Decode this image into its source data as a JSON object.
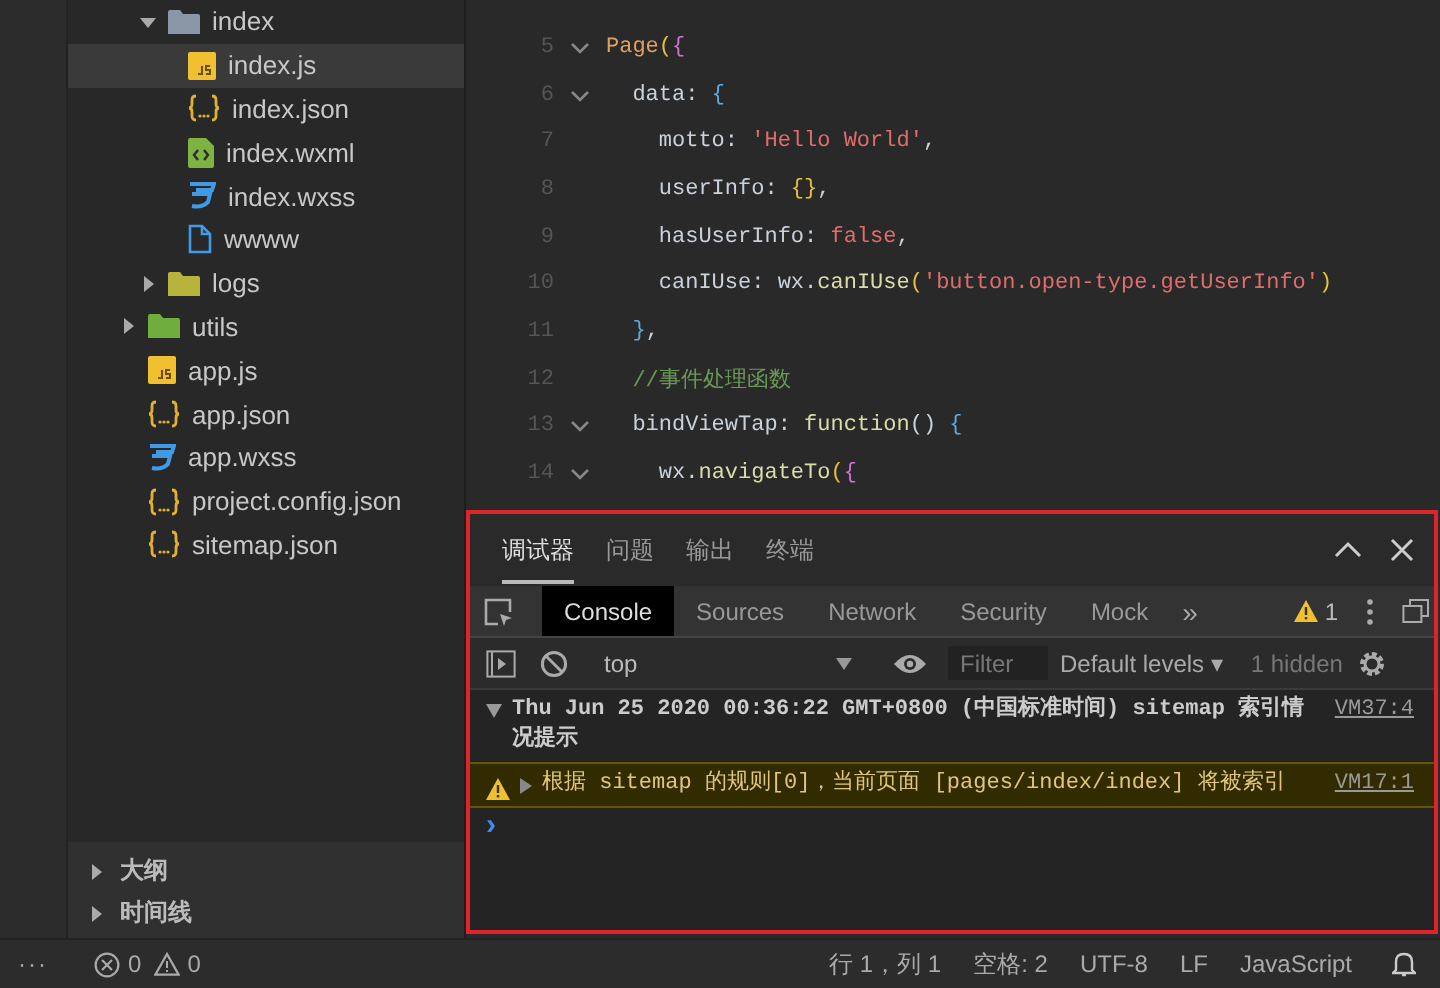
{
  "sidebar": {
    "tree_inner": [
      {
        "name": "index",
        "kind": "folder",
        "color": "#8a97a6",
        "expanded": true,
        "selected": false,
        "children": [
          {
            "name": "index.js",
            "kind": "js",
            "selected": true
          },
          {
            "name": "index.json",
            "kind": "json",
            "selected": false
          },
          {
            "name": "index.wxml",
            "kind": "wxml",
            "selected": false
          },
          {
            "name": "index.wxss",
            "kind": "wxss",
            "selected": false
          },
          {
            "name": "wwww",
            "kind": "file",
            "selected": false
          }
        ]
      },
      {
        "name": "logs",
        "kind": "folder",
        "color": "#b8b33a",
        "expanded": false,
        "selected": false
      }
    ],
    "tree": [
      {
        "name": "utils",
        "kind": "folder",
        "color": "#6fae3e",
        "expanded": false,
        "selected": false
      },
      {
        "name": "app.js",
        "kind": "js",
        "selected": false
      },
      {
        "name": "app.json",
        "kind": "json",
        "selected": false
      },
      {
        "name": "app.wxss",
        "kind": "wxss",
        "selected": false
      },
      {
        "name": "project.config.json",
        "kind": "json",
        "selected": false
      },
      {
        "name": "sitemap.json",
        "kind": "json",
        "selected": false
      }
    ],
    "sections": [
      {
        "label": "大纲",
        "expanded": false
      },
      {
        "label": "时间线",
        "expanded": false
      }
    ]
  },
  "editor": {
    "lines": [
      {
        "number": "5",
        "fold": true,
        "tokens": [
          {
            "t": "Page",
            "kind": "fn"
          },
          {
            "t": "(",
            "kind": "brace"
          },
          {
            "t": "{",
            "kind": "brace2"
          }
        ]
      },
      {
        "number": "6",
        "fold": true,
        "tokens": [
          {
            "t": "  data",
            "kind": "key"
          },
          {
            "t": ": ",
            "kind": "punc"
          },
          {
            "t": "{",
            "kind": "brace3"
          }
        ]
      },
      {
        "number": "7",
        "fold": false,
        "tokens": [
          {
            "t": "    motto",
            "kind": "key"
          },
          {
            "t": ": ",
            "kind": "punc"
          },
          {
            "t": "'Hello World'",
            "kind": "str"
          },
          {
            "t": ",",
            "kind": "punc"
          }
        ]
      },
      {
        "number": "8",
        "fold": false,
        "tokens": [
          {
            "t": "    userInfo",
            "kind": "key"
          },
          {
            "t": ": ",
            "kind": "punc"
          },
          {
            "t": "{}",
            "kind": "brace"
          },
          {
            "t": ",",
            "kind": "punc"
          }
        ]
      },
      {
        "number": "9",
        "fold": false,
        "tokens": [
          {
            "t": "    hasUserInfo",
            "kind": "key"
          },
          {
            "t": ": ",
            "kind": "punc"
          },
          {
            "t": "false",
            "kind": "str"
          },
          {
            "t": ",",
            "kind": "punc"
          }
        ]
      },
      {
        "number": "10",
        "fold": false,
        "tokens": [
          {
            "t": "    canIUse",
            "kind": "key"
          },
          {
            "t": ": ",
            "kind": "punc"
          },
          {
            "t": "wx",
            "kind": "key"
          },
          {
            "t": ".",
            "kind": "punc"
          },
          {
            "t": "canIUse",
            "kind": "call"
          },
          {
            "t": "(",
            "kind": "brace"
          },
          {
            "t": "'button.open-type.getUserInfo'",
            "kind": "str"
          },
          {
            "t": ")",
            "kind": "brace"
          }
        ]
      },
      {
        "number": "11",
        "fold": false,
        "tokens": [
          {
            "t": "  }",
            "kind": "brace3"
          },
          {
            "t": ",",
            "kind": "punc"
          }
        ]
      },
      {
        "number": "12",
        "fold": false,
        "tokens": [
          {
            "t": "  //事件处理函数",
            "kind": "comment"
          }
        ]
      },
      {
        "number": "13",
        "fold": true,
        "tokens": [
          {
            "t": "  bindViewTap",
            "kind": "key"
          },
          {
            "t": ": ",
            "kind": "punc"
          },
          {
            "t": "function",
            "kind": "call"
          },
          {
            "t": "() ",
            "kind": "punc"
          },
          {
            "t": "{",
            "kind": "brace3"
          }
        ]
      },
      {
        "number": "14",
        "fold": true,
        "tokens": [
          {
            "t": "    wx",
            "kind": "key"
          },
          {
            "t": ".",
            "kind": "punc"
          },
          {
            "t": "navigateTo",
            "kind": "call"
          },
          {
            "t": "(",
            "kind": "brace"
          },
          {
            "t": "{",
            "kind": "brace2"
          }
        ]
      }
    ]
  },
  "panel": {
    "tabs": [
      {
        "label": "调试器",
        "selected": true
      },
      {
        "label": "问题",
        "selected": false
      },
      {
        "label": "输出",
        "selected": false
      },
      {
        "label": "终端",
        "selected": false
      }
    ],
    "devtools_tabs": [
      {
        "label": "Console",
        "selected": true
      },
      {
        "label": "Sources",
        "selected": false
      },
      {
        "label": "Network",
        "selected": false
      },
      {
        "label": "Security",
        "selected": false
      },
      {
        "label": "Mock",
        "selected": false
      }
    ],
    "more_tabs": "»",
    "warning_count": "1",
    "context": "top",
    "filter": {
      "placeholder": "Filter"
    },
    "levels": "Default levels ▾",
    "hidden": "1 hidden",
    "messages": [
      {
        "kind": "group",
        "text": "Thu Jun 25 2020 00:36:22 GMT+0800 (中国标准时间) sitemap 索引情况提示",
        "source": "VM37:4"
      },
      {
        "kind": "warning",
        "text": "根据 sitemap 的规则[0]，当前页面 [pages/index/index] 将被索引",
        "source": "VM17:1"
      }
    ],
    "prompt": "›"
  },
  "status_bar": {
    "more": "···",
    "errors": "0",
    "warnings": "0",
    "items": [
      "行 1，列 1",
      "空格: 2",
      "UTF-8",
      "LF",
      "JavaScript"
    ]
  }
}
